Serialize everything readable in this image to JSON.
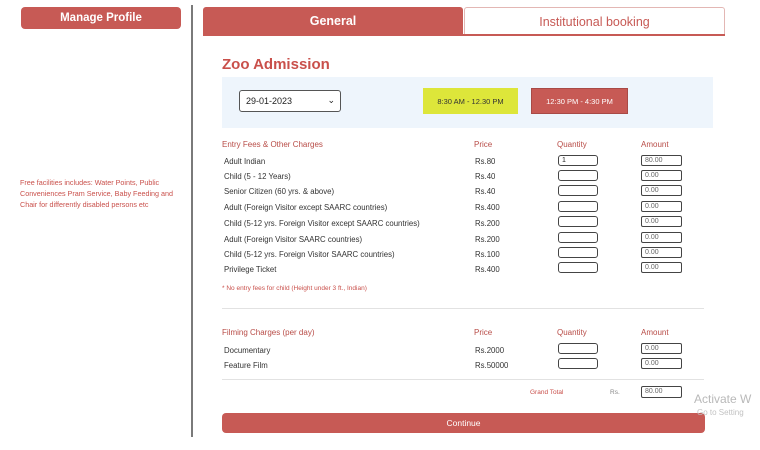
{
  "sidebar": {
    "manage_profile": "Manage Profile",
    "facilities_note": "Free facilities includes: Water Points, Public Conveniences Pram Service, Baby Feeding and Chair for differently disabled persons etc"
  },
  "tabs": [
    {
      "label": "General",
      "active": true
    },
    {
      "label": "Institutional booking",
      "active": false
    }
  ],
  "section_title": "Zoo Admission",
  "date_select": {
    "value": "29-01-2023"
  },
  "time_slots": [
    {
      "label": "8:30 AM - 12.30 PM",
      "color": "#dde63a"
    },
    {
      "label": "12:30 PM - 4:30 PM",
      "color": "#c75a55"
    }
  ],
  "entry": {
    "headers": {
      "item": "Entry Fees & Other Charges",
      "price": "Price",
      "quantity": "Quantity",
      "amount": "Amount"
    },
    "rows": [
      {
        "label": "Adult Indian",
        "price": "Rs.80",
        "quantity": "1",
        "amount": "80.00"
      },
      {
        "label": "Child (5 - 12 Years)",
        "price": "Rs.40",
        "quantity": "",
        "amount": "0.00"
      },
      {
        "label": "Senior Citizen (60 yrs. & above)",
        "price": "Rs.40",
        "quantity": "",
        "amount": "0.00"
      },
      {
        "label": "Adult (Foreign Visitor except SAARC countries)",
        "price": "Rs.400",
        "quantity": "",
        "amount": "0.00"
      },
      {
        "label": "Child (5-12 yrs. Foreign Visitor except SAARC countries)",
        "price": "Rs.200",
        "quantity": "",
        "amount": "0.00"
      },
      {
        "label": "Adult (Foreign Visitor SAARC countries)",
        "price": "Rs.200",
        "quantity": "",
        "amount": "0.00"
      },
      {
        "label": "Child (5-12 yrs. Foreign Visitor SAARC countries)",
        "price": "Rs.100",
        "quantity": "",
        "amount": "0.00"
      },
      {
        "label": "Privilege Ticket",
        "price": "Rs.400",
        "quantity": "",
        "amount": "0.00"
      }
    ],
    "note": "* No entry fees for child (Height under 3 ft., Indian)"
  },
  "filming": {
    "headers": {
      "item": "Filming Charges (per day)",
      "price": "Price",
      "quantity": "Quantity",
      "amount": "Amount"
    },
    "rows": [
      {
        "label": "Documentary",
        "price": "Rs.2000",
        "quantity": "",
        "amount": "0.00"
      },
      {
        "label": "Feature Film",
        "price": "Rs.50000",
        "quantity": "",
        "amount": "0.00"
      }
    ]
  },
  "grand_total": {
    "label": "Grand Total",
    "currency": "Rs.",
    "value": "80.00"
  },
  "continue_label": "Continue",
  "watermark": {
    "line1": "Activate W",
    "line2": "Go to Setting"
  }
}
